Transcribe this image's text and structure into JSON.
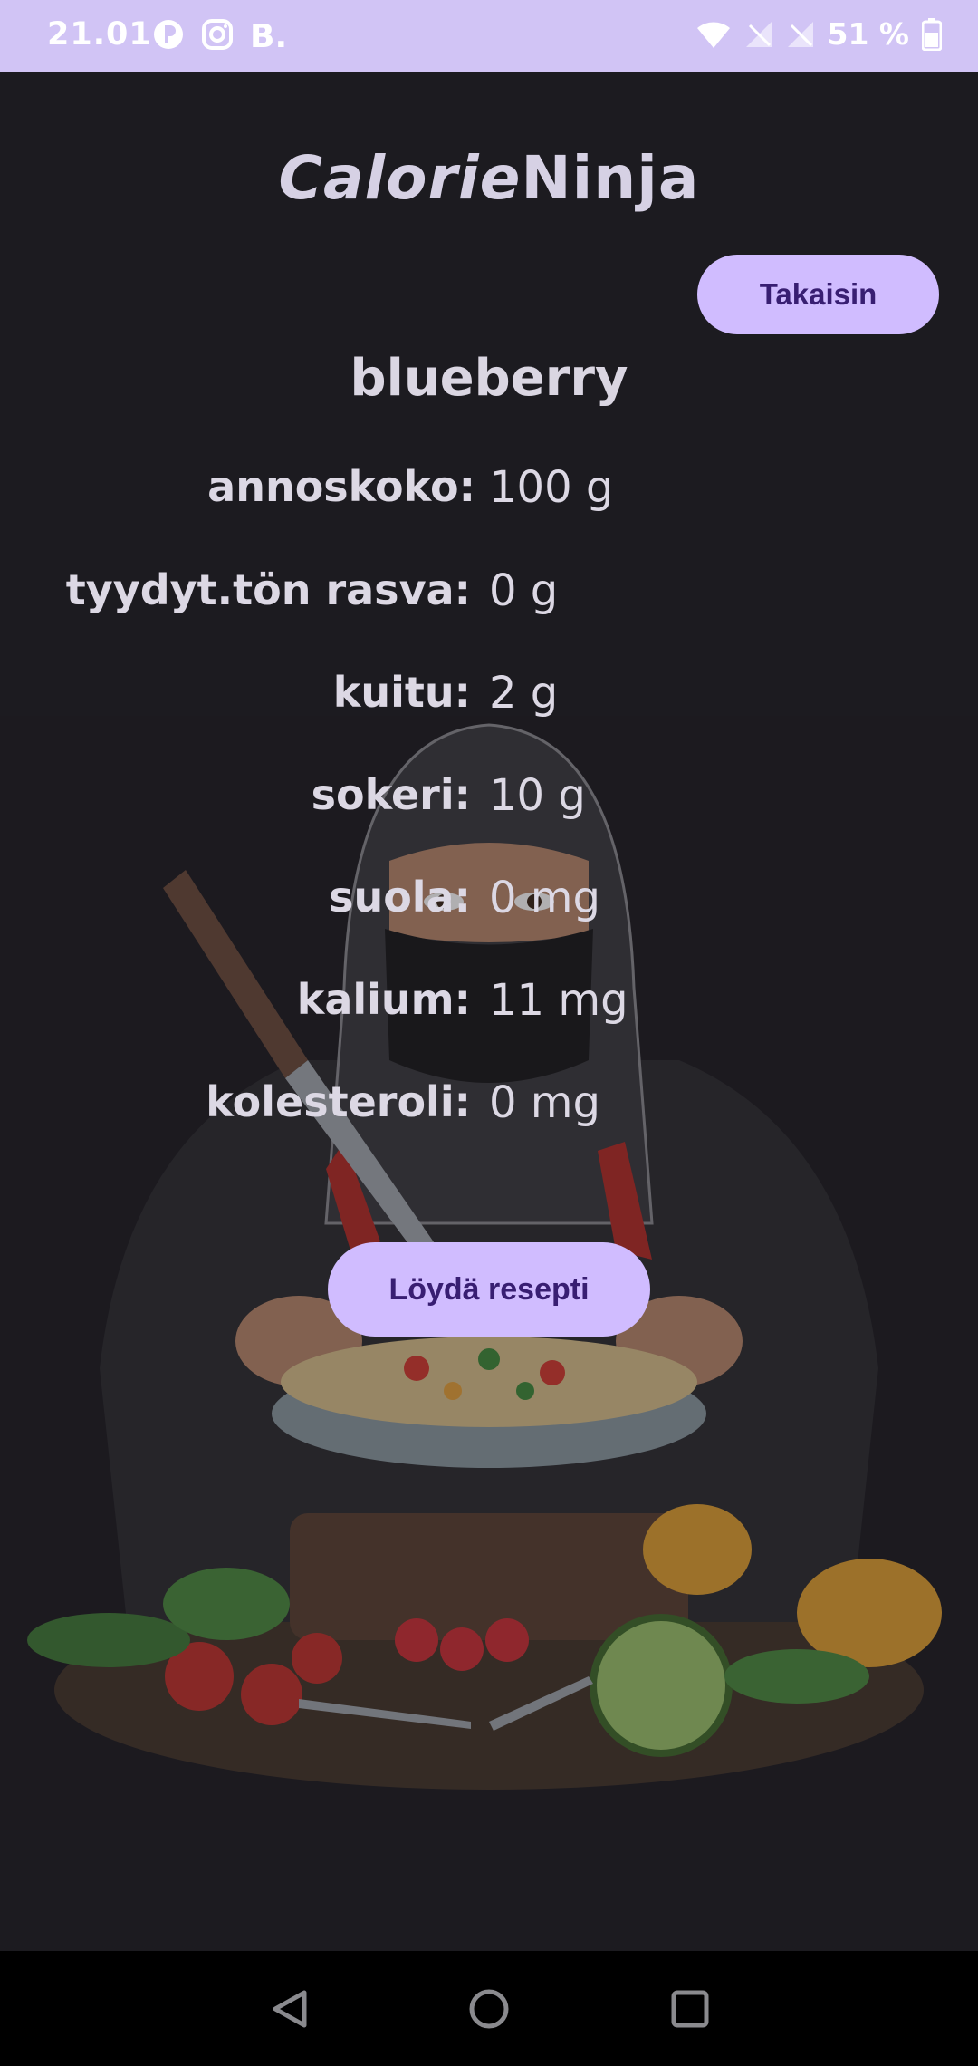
{
  "status_bar": {
    "time": "21.01",
    "battery_percent": "51 %",
    "icons": [
      "notification-app-icon",
      "instagram-icon",
      "b-app-icon",
      "wifi-icon",
      "no-signal-icon",
      "no-signal-icon",
      "battery-icon"
    ]
  },
  "app": {
    "title_part1": "Calorie",
    "title_part2": "Ninja"
  },
  "buttons": {
    "back": "Takaisin",
    "find_recipe": "Löydä resepti"
  },
  "food": {
    "name": "blueberry",
    "nutrients": [
      {
        "label": "annoskoko:",
        "value": "100 g"
      },
      {
        "label": "tyydyt.tön rasva:",
        "value": "0 g"
      },
      {
        "label": "kuitu:",
        "value": "2 g"
      },
      {
        "label": "sokeri:",
        "value": "10 g"
      },
      {
        "label": "suola:",
        "value": "0 mg"
      },
      {
        "label": "kalium:",
        "value": "11 mg"
      },
      {
        "label": "kolesteroli:",
        "value": "0 mg"
      }
    ]
  },
  "colors": {
    "background": "#1c1b20",
    "status_bar": "#d1c4f5",
    "button": "#d0bcff",
    "button_text": "#381e72",
    "text": "#dcd8e4"
  },
  "nav_bar": {
    "icons": [
      "back-triangle-icon",
      "home-circle-icon",
      "recents-square-icon"
    ]
  }
}
